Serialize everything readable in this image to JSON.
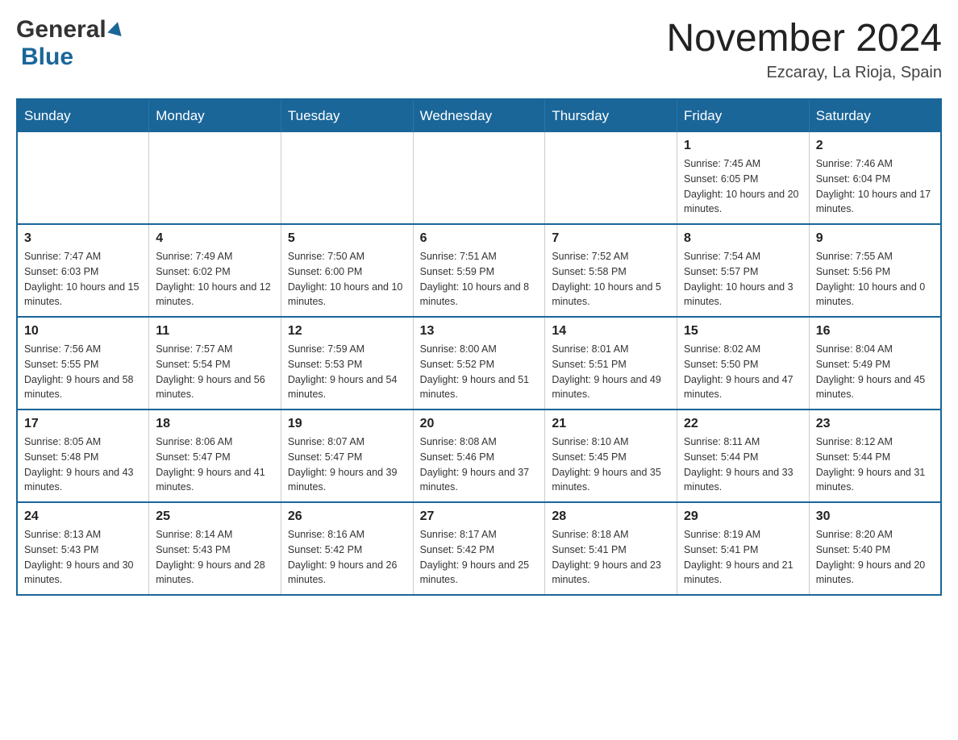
{
  "header": {
    "logo_general": "General",
    "logo_blue": "Blue",
    "month_title": "November 2024",
    "location": "Ezcaray, La Rioja, Spain"
  },
  "weekdays": [
    "Sunday",
    "Monday",
    "Tuesday",
    "Wednesday",
    "Thursday",
    "Friday",
    "Saturday"
  ],
  "weeks": [
    [
      {
        "day": "",
        "sunrise": "",
        "sunset": "",
        "daylight": ""
      },
      {
        "day": "",
        "sunrise": "",
        "sunset": "",
        "daylight": ""
      },
      {
        "day": "",
        "sunrise": "",
        "sunset": "",
        "daylight": ""
      },
      {
        "day": "",
        "sunrise": "",
        "sunset": "",
        "daylight": ""
      },
      {
        "day": "",
        "sunrise": "",
        "sunset": "",
        "daylight": ""
      },
      {
        "day": "1",
        "sunrise": "Sunrise: 7:45 AM",
        "sunset": "Sunset: 6:05 PM",
        "daylight": "Daylight: 10 hours and 20 minutes."
      },
      {
        "day": "2",
        "sunrise": "Sunrise: 7:46 AM",
        "sunset": "Sunset: 6:04 PM",
        "daylight": "Daylight: 10 hours and 17 minutes."
      }
    ],
    [
      {
        "day": "3",
        "sunrise": "Sunrise: 7:47 AM",
        "sunset": "Sunset: 6:03 PM",
        "daylight": "Daylight: 10 hours and 15 minutes."
      },
      {
        "day": "4",
        "sunrise": "Sunrise: 7:49 AM",
        "sunset": "Sunset: 6:02 PM",
        "daylight": "Daylight: 10 hours and 12 minutes."
      },
      {
        "day": "5",
        "sunrise": "Sunrise: 7:50 AM",
        "sunset": "Sunset: 6:00 PM",
        "daylight": "Daylight: 10 hours and 10 minutes."
      },
      {
        "day": "6",
        "sunrise": "Sunrise: 7:51 AM",
        "sunset": "Sunset: 5:59 PM",
        "daylight": "Daylight: 10 hours and 8 minutes."
      },
      {
        "day": "7",
        "sunrise": "Sunrise: 7:52 AM",
        "sunset": "Sunset: 5:58 PM",
        "daylight": "Daylight: 10 hours and 5 minutes."
      },
      {
        "day": "8",
        "sunrise": "Sunrise: 7:54 AM",
        "sunset": "Sunset: 5:57 PM",
        "daylight": "Daylight: 10 hours and 3 minutes."
      },
      {
        "day": "9",
        "sunrise": "Sunrise: 7:55 AM",
        "sunset": "Sunset: 5:56 PM",
        "daylight": "Daylight: 10 hours and 0 minutes."
      }
    ],
    [
      {
        "day": "10",
        "sunrise": "Sunrise: 7:56 AM",
        "sunset": "Sunset: 5:55 PM",
        "daylight": "Daylight: 9 hours and 58 minutes."
      },
      {
        "day": "11",
        "sunrise": "Sunrise: 7:57 AM",
        "sunset": "Sunset: 5:54 PM",
        "daylight": "Daylight: 9 hours and 56 minutes."
      },
      {
        "day": "12",
        "sunrise": "Sunrise: 7:59 AM",
        "sunset": "Sunset: 5:53 PM",
        "daylight": "Daylight: 9 hours and 54 minutes."
      },
      {
        "day": "13",
        "sunrise": "Sunrise: 8:00 AM",
        "sunset": "Sunset: 5:52 PM",
        "daylight": "Daylight: 9 hours and 51 minutes."
      },
      {
        "day": "14",
        "sunrise": "Sunrise: 8:01 AM",
        "sunset": "Sunset: 5:51 PM",
        "daylight": "Daylight: 9 hours and 49 minutes."
      },
      {
        "day": "15",
        "sunrise": "Sunrise: 8:02 AM",
        "sunset": "Sunset: 5:50 PM",
        "daylight": "Daylight: 9 hours and 47 minutes."
      },
      {
        "day": "16",
        "sunrise": "Sunrise: 8:04 AM",
        "sunset": "Sunset: 5:49 PM",
        "daylight": "Daylight: 9 hours and 45 minutes."
      }
    ],
    [
      {
        "day": "17",
        "sunrise": "Sunrise: 8:05 AM",
        "sunset": "Sunset: 5:48 PM",
        "daylight": "Daylight: 9 hours and 43 minutes."
      },
      {
        "day": "18",
        "sunrise": "Sunrise: 8:06 AM",
        "sunset": "Sunset: 5:47 PM",
        "daylight": "Daylight: 9 hours and 41 minutes."
      },
      {
        "day": "19",
        "sunrise": "Sunrise: 8:07 AM",
        "sunset": "Sunset: 5:47 PM",
        "daylight": "Daylight: 9 hours and 39 minutes."
      },
      {
        "day": "20",
        "sunrise": "Sunrise: 8:08 AM",
        "sunset": "Sunset: 5:46 PM",
        "daylight": "Daylight: 9 hours and 37 minutes."
      },
      {
        "day": "21",
        "sunrise": "Sunrise: 8:10 AM",
        "sunset": "Sunset: 5:45 PM",
        "daylight": "Daylight: 9 hours and 35 minutes."
      },
      {
        "day": "22",
        "sunrise": "Sunrise: 8:11 AM",
        "sunset": "Sunset: 5:44 PM",
        "daylight": "Daylight: 9 hours and 33 minutes."
      },
      {
        "day": "23",
        "sunrise": "Sunrise: 8:12 AM",
        "sunset": "Sunset: 5:44 PM",
        "daylight": "Daylight: 9 hours and 31 minutes."
      }
    ],
    [
      {
        "day": "24",
        "sunrise": "Sunrise: 8:13 AM",
        "sunset": "Sunset: 5:43 PM",
        "daylight": "Daylight: 9 hours and 30 minutes."
      },
      {
        "day": "25",
        "sunrise": "Sunrise: 8:14 AM",
        "sunset": "Sunset: 5:43 PM",
        "daylight": "Daylight: 9 hours and 28 minutes."
      },
      {
        "day": "26",
        "sunrise": "Sunrise: 8:16 AM",
        "sunset": "Sunset: 5:42 PM",
        "daylight": "Daylight: 9 hours and 26 minutes."
      },
      {
        "day": "27",
        "sunrise": "Sunrise: 8:17 AM",
        "sunset": "Sunset: 5:42 PM",
        "daylight": "Daylight: 9 hours and 25 minutes."
      },
      {
        "day": "28",
        "sunrise": "Sunrise: 8:18 AM",
        "sunset": "Sunset: 5:41 PM",
        "daylight": "Daylight: 9 hours and 23 minutes."
      },
      {
        "day": "29",
        "sunrise": "Sunrise: 8:19 AM",
        "sunset": "Sunset: 5:41 PM",
        "daylight": "Daylight: 9 hours and 21 minutes."
      },
      {
        "day": "30",
        "sunrise": "Sunrise: 8:20 AM",
        "sunset": "Sunset: 5:40 PM",
        "daylight": "Daylight: 9 hours and 20 minutes."
      }
    ]
  ]
}
